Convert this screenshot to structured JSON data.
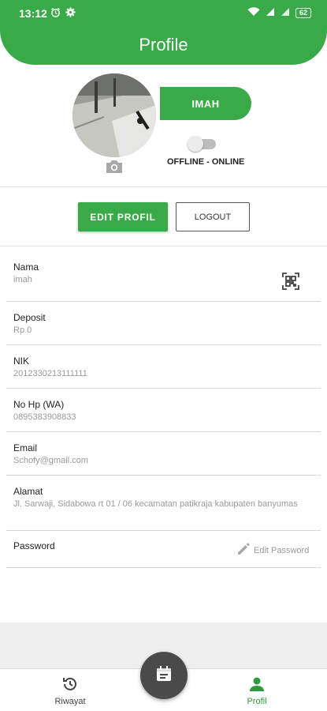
{
  "status_bar": {
    "time": "13:12",
    "battery": "62"
  },
  "header": {
    "title": "Profile"
  },
  "profile": {
    "name": "IMAH",
    "status_label": "OFFLINE - ONLINE",
    "online": false
  },
  "actions": {
    "edit_label": "EDIT PROFIL",
    "logout_label": "LOGOUT"
  },
  "fields": [
    {
      "label": "Nama",
      "value": "imah"
    },
    {
      "label": "Deposit",
      "value": "Rp 0"
    },
    {
      "label": "NIK",
      "value": "2012330213111111"
    },
    {
      "label": "No Hp (WA)",
      "value": "0895383908833"
    },
    {
      "label": "Email",
      "value": "Schofy@gmail.com"
    },
    {
      "label": "Alamat",
      "value": "Jl. Sarwaji, Sidabowa rt 01 / 06 kecamatan patikraja kabupaten banyumas"
    },
    {
      "label": "Password",
      "value": ""
    }
  ],
  "edit_password_label": "Edit Password",
  "bottom_nav": {
    "items": [
      {
        "label": "Riwayat",
        "icon": "history-icon",
        "active": false
      },
      {
        "label": "Profil",
        "icon": "person-icon",
        "active": true
      }
    ],
    "fab_icon": "calendar-icon"
  },
  "colors": {
    "primary": "#3aaa49",
    "fab": "#4a4a4a",
    "inactive_nav": "#444444",
    "muted_text": "#9a9a9a"
  }
}
